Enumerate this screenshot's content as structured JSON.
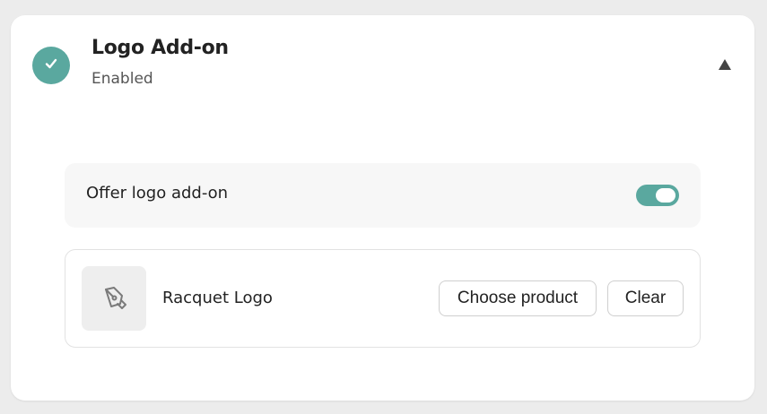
{
  "header": {
    "title": "Logo Add-on",
    "status": "Enabled",
    "status_icon": "check-icon",
    "collapse_icon": "caret-up-icon"
  },
  "offer": {
    "label": "Offer logo add-on",
    "enabled": true
  },
  "product": {
    "name": "Racquet Logo",
    "thumbnail_icon": "pen-tool-icon",
    "choose_label": "Choose product",
    "clear_label": "Clear"
  },
  "colors": {
    "accent": "#5aa89f",
    "card_background": "#ffffff",
    "page_background": "#ececec"
  }
}
